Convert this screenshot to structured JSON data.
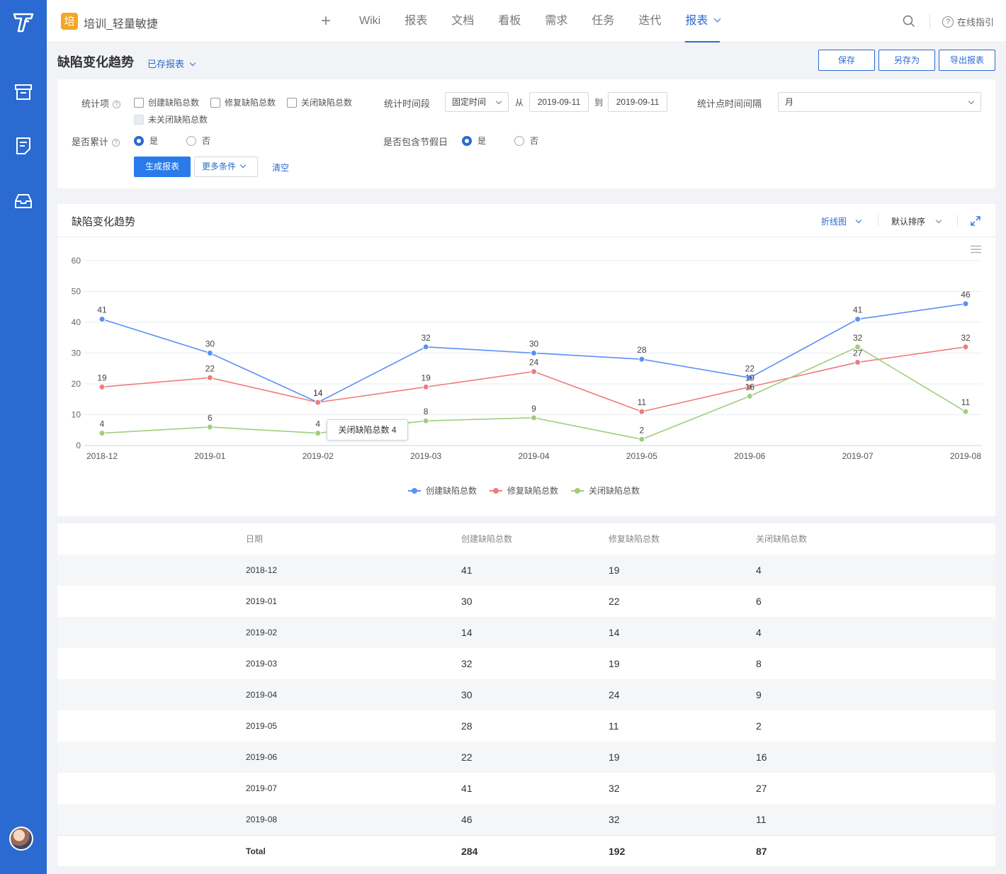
{
  "project": {
    "badge": "培",
    "name": "培训_轻量敏捷"
  },
  "topnav": {
    "add": "+",
    "items": [
      "Wiki",
      "报表",
      "文档",
      "看板",
      "需求",
      "任务",
      "迭代"
    ],
    "active": "报表",
    "guide": "在线指引",
    "help_glyph": "?"
  },
  "page": {
    "title": "缺陷变化趋势",
    "saved_reports": "已存报表",
    "buttons": {
      "save": "保存",
      "save_as": "另存为",
      "export": "导出报表"
    }
  },
  "filters": {
    "stat_items_label": "统计项",
    "checkboxes": [
      "创建缺陷总数",
      "修复缺陷总数",
      "关闭缺陷总数",
      "未关闭缺陷总数"
    ],
    "period_label": "统计时间段",
    "period_type": "固定时间",
    "from_label": "从",
    "from_date": "2019-09-11",
    "to_label": "到",
    "to_date": "2019-09-11",
    "interval_label": "统计点时间间隔",
    "interval": "月",
    "cumulative_label": "是否累计",
    "holiday_label": "是否包含节假日",
    "yes": "是",
    "no": "否",
    "generate": "生成报表",
    "more": "更多条件",
    "clear": "清空"
  },
  "chart_panel": {
    "title": "缺陷变化趋势",
    "chart_type": "折线图",
    "sort": "默认排序",
    "tooltip": "关闭缺陷总数 4"
  },
  "chart_data": {
    "type": "line",
    "categories": [
      "2018-12",
      "2019-01",
      "2019-02",
      "2019-03",
      "2019-04",
      "2019-05",
      "2019-06",
      "2019-07",
      "2019-08"
    ],
    "series": [
      {
        "name": "创建缺陷总数",
        "color": "#5b8ff9",
        "values": [
          41,
          30,
          14,
          32,
          30,
          28,
          22,
          41,
          46
        ]
      },
      {
        "name": "修复缺陷总数",
        "color": "#f07c7c",
        "values": [
          19,
          22,
          14,
          19,
          24,
          11,
          19,
          27,
          32
        ]
      },
      {
        "name": "关闭缺陷总数",
        "color": "#9fcf7d",
        "values": [
          4,
          6,
          4,
          8,
          9,
          2,
          16,
          32,
          11
        ]
      }
    ],
    "ylim": [
      0,
      60
    ],
    "yticks": [
      0,
      10,
      20,
      30,
      40,
      50,
      60
    ],
    "grid": true,
    "legend": "bottom"
  },
  "table": {
    "headers": [
      "日期",
      "创建缺陷总数",
      "修复缺陷总数",
      "关闭缺陷总数"
    ],
    "rows": [
      [
        "2018-12",
        "41",
        "19",
        "4"
      ],
      [
        "2019-01",
        "30",
        "22",
        "6"
      ],
      [
        "2019-02",
        "14",
        "14",
        "4"
      ],
      [
        "2019-03",
        "32",
        "19",
        "8"
      ],
      [
        "2019-04",
        "30",
        "24",
        "9"
      ],
      [
        "2019-05",
        "28",
        "11",
        "2"
      ],
      [
        "2019-06",
        "22",
        "19",
        "16"
      ],
      [
        "2019-07",
        "41",
        "32",
        "27"
      ],
      [
        "2019-08",
        "46",
        "32",
        "11"
      ]
    ],
    "total": [
      "Total",
      "284",
      "192",
      "87"
    ]
  }
}
